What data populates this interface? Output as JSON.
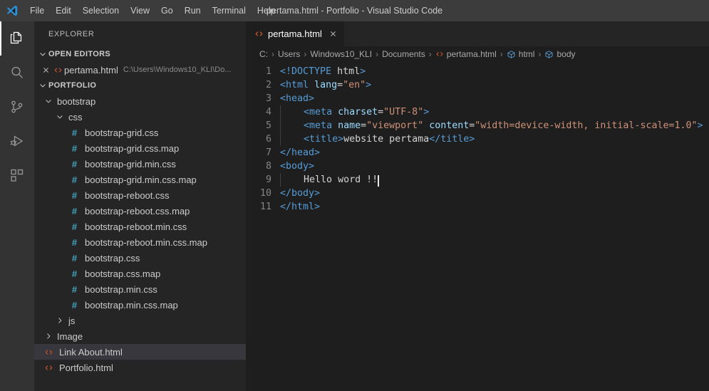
{
  "window": {
    "title": "pertama.html - Portfolio - Visual Studio Code",
    "logo_icon": "vscode-logo-icon"
  },
  "menubar": {
    "items": [
      {
        "label": "File"
      },
      {
        "label": "Edit"
      },
      {
        "label": "Selection"
      },
      {
        "label": "View"
      },
      {
        "label": "Go"
      },
      {
        "label": "Run"
      },
      {
        "label": "Terminal"
      },
      {
        "label": "Help"
      }
    ]
  },
  "activitybar": {
    "items": [
      {
        "name": "explorer",
        "icon": "files-icon",
        "active": true
      },
      {
        "name": "search",
        "icon": "search-icon",
        "active": false
      },
      {
        "name": "source-control",
        "icon": "branch-icon",
        "active": false
      },
      {
        "name": "run-debug",
        "icon": "run-debug-icon",
        "active": false
      },
      {
        "name": "extensions",
        "icon": "extensions-icon",
        "active": false
      }
    ]
  },
  "sidebar": {
    "title": "EXPLORER",
    "open_editors": {
      "label": "OPEN EDITORS",
      "expanded": true,
      "items": [
        {
          "name": "pertama.html",
          "path": "C:\\Users\\Windows10_KLI\\Do...",
          "icon": "html-file-icon",
          "close_icon": "close-icon"
        }
      ]
    },
    "folder": {
      "label": "PORTFOLIO",
      "expanded": true,
      "items": [
        {
          "label": "bootstrap",
          "type": "folder",
          "expanded": true,
          "indent": 1
        },
        {
          "label": "css",
          "type": "folder",
          "expanded": true,
          "indent": 2
        },
        {
          "label": "bootstrap-grid.css",
          "type": "css",
          "indent": 3
        },
        {
          "label": "bootstrap-grid.css.map",
          "type": "css",
          "indent": 3
        },
        {
          "label": "bootstrap-grid.min.css",
          "type": "css",
          "indent": 3
        },
        {
          "label": "bootstrap-grid.min.css.map",
          "type": "css",
          "indent": 3
        },
        {
          "label": "bootstrap-reboot.css",
          "type": "css",
          "indent": 3
        },
        {
          "label": "bootstrap-reboot.css.map",
          "type": "css",
          "indent": 3
        },
        {
          "label": "bootstrap-reboot.min.css",
          "type": "css",
          "indent": 3
        },
        {
          "label": "bootstrap-reboot.min.css.map",
          "type": "css",
          "indent": 3
        },
        {
          "label": "bootstrap.css",
          "type": "css",
          "indent": 3
        },
        {
          "label": "bootstrap.css.map",
          "type": "css",
          "indent": 3
        },
        {
          "label": "bootstrap.min.css",
          "type": "css",
          "indent": 3
        },
        {
          "label": "bootstrap.min.css.map",
          "type": "css",
          "indent": 3
        },
        {
          "label": "js",
          "type": "folder",
          "expanded": false,
          "indent": 2
        },
        {
          "label": "Image",
          "type": "folder",
          "expanded": false,
          "indent": 1
        },
        {
          "label": "Link About.html",
          "type": "html",
          "indent": 1,
          "selected": true
        },
        {
          "label": "Portfolio.html",
          "type": "html",
          "indent": 1
        }
      ]
    }
  },
  "editor": {
    "tabs": [
      {
        "label": "pertama.html",
        "icon": "html-file-icon",
        "close_icon": "close-icon",
        "active": true
      }
    ],
    "breadcrumbs": [
      {
        "label": "C:",
        "icon": ""
      },
      {
        "label": "Users",
        "icon": ""
      },
      {
        "label": "Windows10_KLI",
        "icon": ""
      },
      {
        "label": "Documents",
        "icon": ""
      },
      {
        "label": "pertama.html",
        "icon": "html-file-icon"
      },
      {
        "label": "html",
        "icon": "symbol-cube-icon"
      },
      {
        "label": "body",
        "icon": "symbol-cube-icon"
      }
    ],
    "line_numbers": [
      "1",
      "2",
      "3",
      "4",
      "5",
      "6",
      "7",
      "8",
      "9",
      "10",
      "11"
    ],
    "code_text": [
      "<!DOCTYPE html>",
      "<html lang=\"en\">",
      "<head>",
      "    <meta charset=\"UTF-8\">",
      "    <meta name=\"viewport\" content=\"width=device-width, initial-scale=1.0\">",
      "    <title>website pertama</title>",
      "</head>",
      "<body>",
      "    Hello word !!",
      "</body>",
      "</html>"
    ]
  },
  "colors": {
    "editor_bg": "#1e1e1e",
    "sidebar_bg": "#252526",
    "activitybar_bg": "#333333",
    "titlebar_bg": "#3c3c3c",
    "tag": "#569cd6",
    "attribute": "#9cdcfe",
    "string": "#ce9178",
    "plain_text": "#d4d4d4",
    "line_number": "#858585",
    "css_icon": "#42a5bd",
    "html_icon": "#c2502a",
    "selection": "#37373d"
  }
}
